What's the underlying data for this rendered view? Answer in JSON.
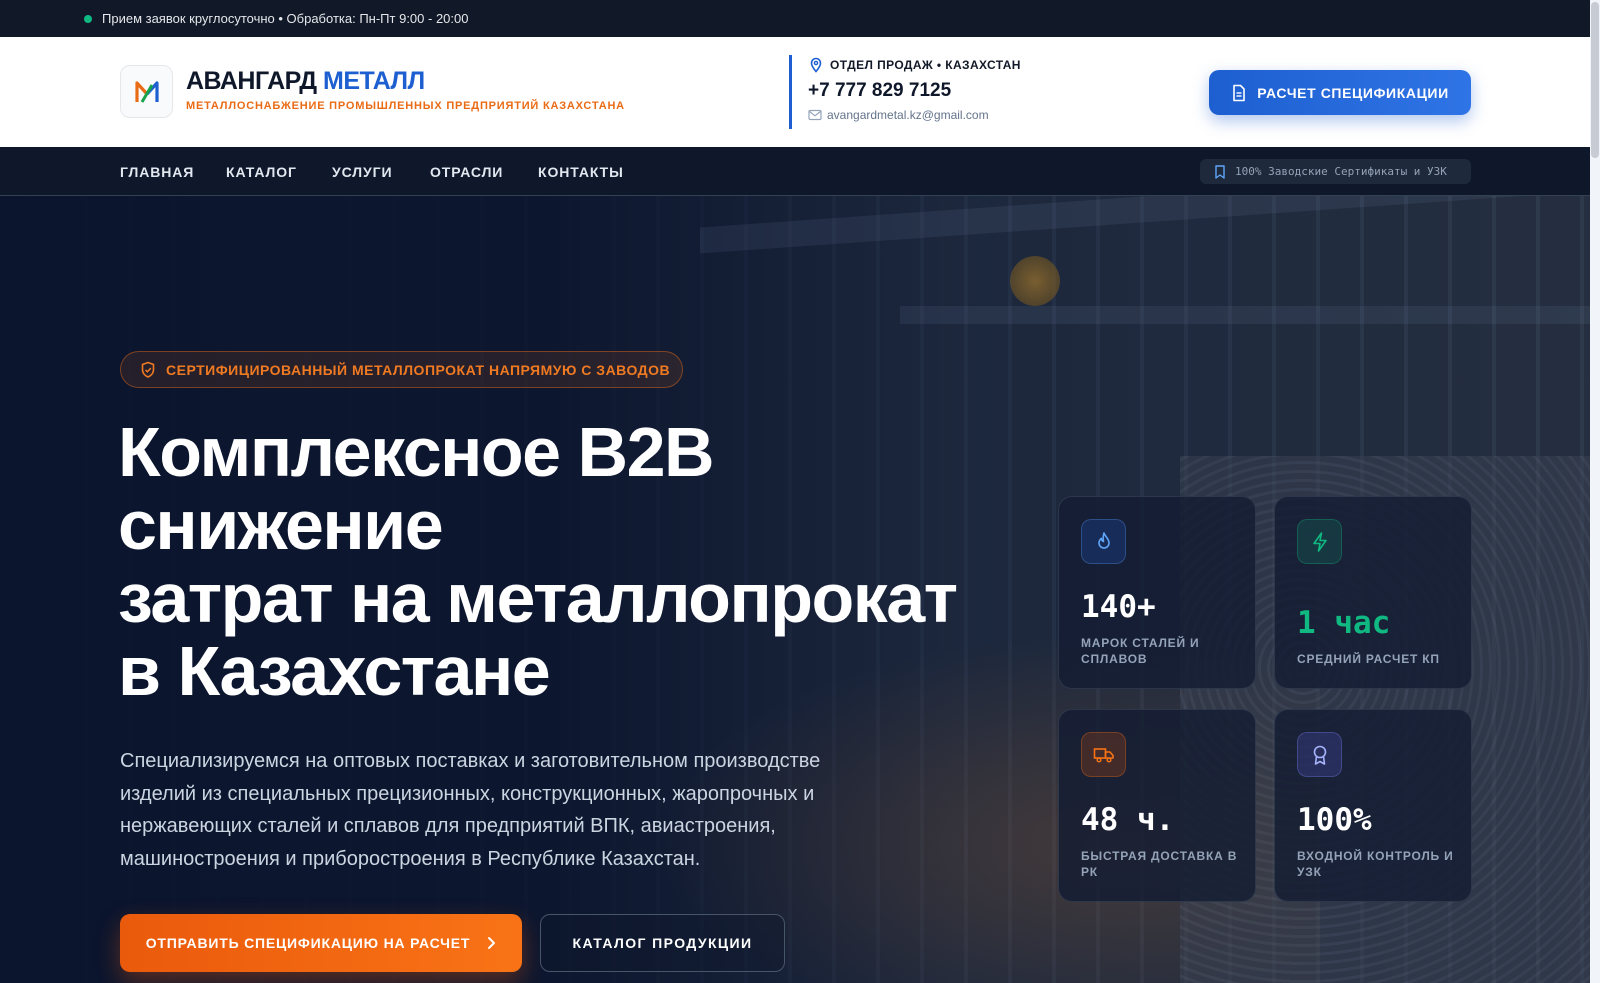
{
  "topbar": {
    "text": "Прием заявок круглосуточно • Обработка: Пн-Пт 9:00 - 20:00"
  },
  "header": {
    "brand_main": "АВАНГАРД",
    "brand_accent": "МЕТАЛЛ",
    "tagline": "МЕТАЛЛОСНАБЖЕНИЕ ПРОМЫШЛЕННЫХ ПРЕДПРИЯТИЙ КАЗАХСТАНА",
    "contact": {
      "dept": "ОТДЕЛ ПРОДАЖ • КАЗАХСТАН",
      "phone": "+7 777 829 7125",
      "email": "avangardmetal.kz@gmail.com"
    },
    "cta_label": "РАСЧЕТ СПЕЦИФИКАЦИИ"
  },
  "nav": {
    "items": [
      "ГЛАВНАЯ",
      "КАТАЛОГ",
      "УСЛУГИ",
      "ОТРАСЛИ",
      "КОНТАКТЫ"
    ],
    "cert_label": "100% Заводские Сертификаты и УЗК"
  },
  "hero": {
    "badge": "СЕРТИФИЦИРОВАННЫЙ МЕТАЛЛОПРОКАТ НАПРЯМУЮ С ЗАВОДОВ",
    "title_lines": [
      "Комплексное B2B",
      "снижение",
      "затрат на металлопрокат",
      "в Казахстане"
    ],
    "lead": "Специализируемся на оптовых поставках и заготовительном производстве изделий из специальных прецизионных, конструкционных, жаропрочных и нержавеющих сталей и сплавов для предприятий ВПК, авиастроения, машиностроения и приборостроения в Республике Казахстан.",
    "primary_button": "ОТПРАВИТЬ СПЕЦИФИКАЦИЮ НА РАСЧЕТ",
    "secondary_button": "КАТАЛОГ ПРОДУКЦИИ"
  },
  "stats": [
    {
      "value": "140+",
      "label": "МАРОК СТАЛЕЙ И СПЛАВОВ",
      "icon": "flame-icon",
      "color": "#60a5fa"
    },
    {
      "value": "1 час",
      "label": "СРЕДНИЙ РАСЧЕТ КП",
      "icon": "lightning-icon",
      "color": "#10b981"
    },
    {
      "value": "48 ч.",
      "label": "БЫСТРАЯ ДОСТАВКА В РК",
      "icon": "truck-icon",
      "color": "#f97316"
    },
    {
      "value": "100%",
      "label": "ВХОДНОЙ КОНТРОЛЬ И УЗК",
      "icon": "award-icon",
      "color": "#818cf8"
    }
  ],
  "colors": {
    "brand_blue": "#1d5fd0",
    "brand_orange": "#ea6b15",
    "dark_bg": "#0f172a",
    "accent_green": "#10b981"
  }
}
